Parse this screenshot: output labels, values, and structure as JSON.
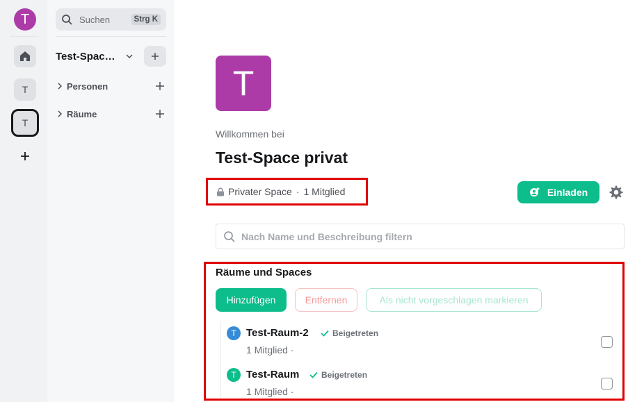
{
  "rail": {
    "user_initial": "T",
    "spaces": [
      {
        "initial": "T"
      },
      {
        "initial": "T"
      }
    ]
  },
  "sidebar": {
    "search_label": "Suchen",
    "search_shortcut": "Strg K",
    "space_name": "Test-Spac…",
    "sections": [
      {
        "label": "Personen"
      },
      {
        "label": "Räume"
      }
    ]
  },
  "main": {
    "space_initial": "T",
    "welcome": "Willkommen bei",
    "title": "Test-Space privat",
    "privacy": "Privater Space",
    "separator": "·",
    "members": "1 Mitglied",
    "invite_label": "Einladen",
    "filter_placeholder": "Nach Name und Beschreibung filtern",
    "rooms_heading": "Räume und Spaces",
    "buttons": {
      "add": "Hinzufügen",
      "remove": "Entfernen",
      "unsuggest": "Als nicht vorgeschlagen markieren"
    },
    "rooms": [
      {
        "initial": "T",
        "name": "Test-Raum-2",
        "status": "Beigetreten",
        "members": "1 Mitglied ·",
        "color": "#368bd6"
      },
      {
        "initial": "T",
        "name": "Test-Raum",
        "status": "Beigetreten",
        "members": "1 Mitglied ·",
        "color": "#0dbd8b"
      }
    ]
  },
  "colors": {
    "accent": "#0dbd8b",
    "space_avatar": "#ac3ba8",
    "highlight": "#e00000"
  }
}
